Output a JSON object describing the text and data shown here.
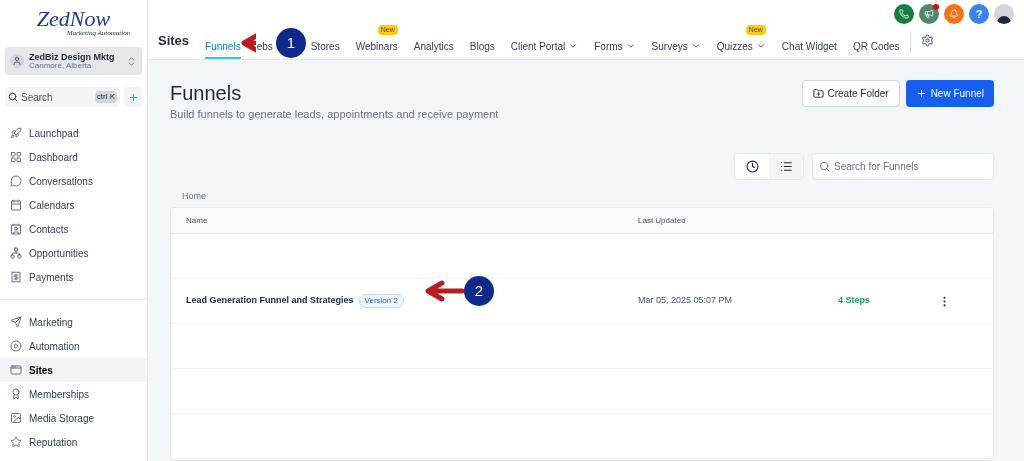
{
  "sidebar": {
    "logo": {
      "title": "ZedNow",
      "tagline": "Marketing Automation"
    },
    "account": {
      "name": "ZedBiz Design Mktg",
      "location": "Canmore, Alberta"
    },
    "search": {
      "placeholder": "Search",
      "shortcut": "ctrl K"
    },
    "groups": [
      [
        {
          "label": "Launchpad",
          "selected": false
        },
        {
          "label": "Dashboard",
          "selected": false
        },
        {
          "label": "Conversations",
          "selected": false
        },
        {
          "label": "Calendars",
          "selected": false
        },
        {
          "label": "Contacts",
          "selected": false
        },
        {
          "label": "Opportunities",
          "selected": false
        },
        {
          "label": "Payments",
          "selected": false
        }
      ],
      [
        {
          "label": "Marketing",
          "selected": false
        },
        {
          "label": "Automation",
          "selected": false
        },
        {
          "label": "Sites",
          "selected": true
        },
        {
          "label": "Memberships",
          "selected": false
        },
        {
          "label": "Media Storage",
          "selected": false
        },
        {
          "label": "Reputation",
          "selected": false
        }
      ]
    ]
  },
  "header": {
    "title": "Sites",
    "help": "?",
    "tabs": [
      {
        "label": "Funnels",
        "selected": true,
        "dropdown": false
      },
      {
        "label": "ebs",
        "selected": false,
        "dropdown": false
      },
      {
        "label": "Stores",
        "selected": false,
        "dropdown": false
      },
      {
        "label": "Webinars",
        "selected": false,
        "dropdown": false,
        "badge": "New"
      },
      {
        "label": "Analytics",
        "selected": false,
        "dropdown": false
      },
      {
        "label": "Blogs",
        "selected": false,
        "dropdown": false
      },
      {
        "label": "Client Portal",
        "selected": false,
        "dropdown": true
      },
      {
        "label": "Forms",
        "selected": false,
        "dropdown": true
      },
      {
        "label": "Surveys",
        "selected": false,
        "dropdown": true
      },
      {
        "label": "Quizzes",
        "selected": false,
        "dropdown": true,
        "badge": "New"
      },
      {
        "label": "Chat Widget",
        "selected": false,
        "dropdown": false
      },
      {
        "label": "QR Codes",
        "selected": false,
        "dropdown": false
      }
    ]
  },
  "page": {
    "title": "Funnels",
    "subtitle": "Build funnels to generate leads, appointments and receive payment",
    "buttons": [
      "Create Folder",
      "New Funnel"
    ],
    "search": {
      "placeholder": "Search for Funnels"
    },
    "breadcrumb": "Home"
  },
  "table": {
    "columns": [
      "Name",
      "Last Updated"
    ],
    "rows": [
      {
        "kind": "empty"
      },
      {
        "kind": "funnel",
        "name": "Lead Generation Funnel and Strategies",
        "version": "Version 2",
        "updated": "Mar 05, 2025 05:07 PM",
        "steps": "4 Steps"
      },
      {
        "kind": "empty"
      },
      {
        "kind": "empty"
      },
      {
        "kind": "empty"
      }
    ]
  },
  "annotations": [
    {
      "number": "1"
    },
    {
      "number": "2"
    }
  ]
}
